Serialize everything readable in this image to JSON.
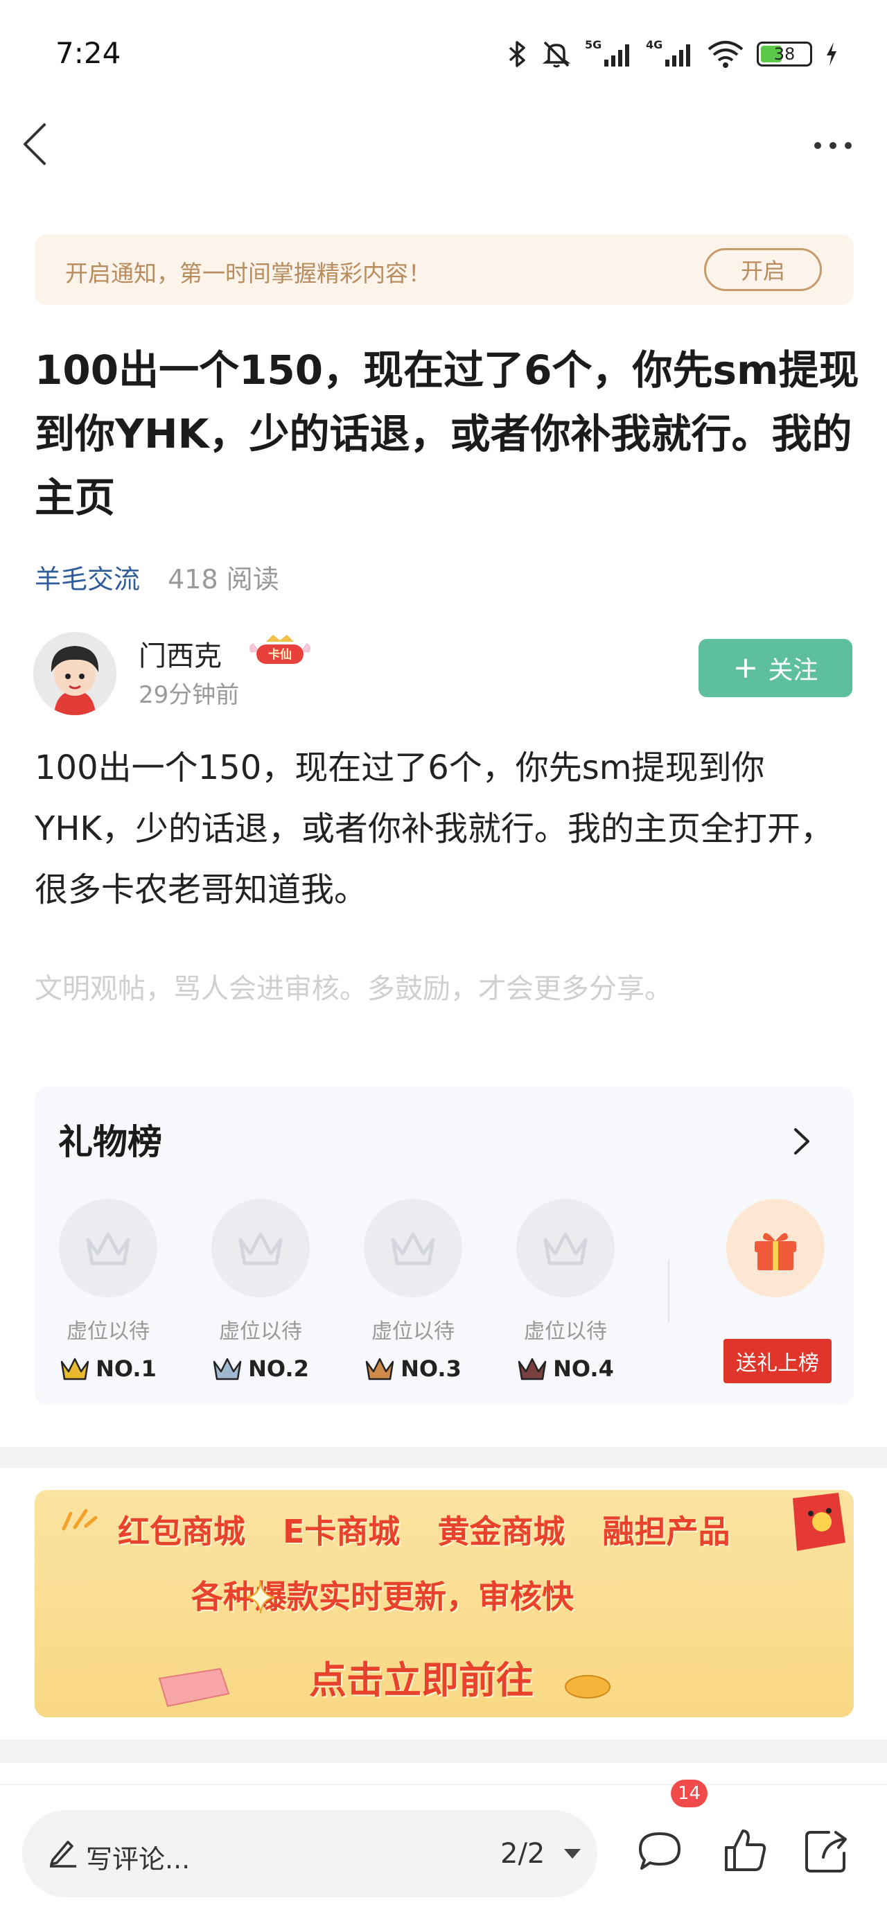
{
  "status_bar": {
    "time": "7:24",
    "network_1": "5G",
    "network_2": "4G",
    "battery": "38"
  },
  "notice": {
    "text": "开启通知，第一时间掌握精彩内容！",
    "button": "开启"
  },
  "post": {
    "title": "100出一个150，现在过了6个，你先sm提现到你YHK，少的话退，或者你补我就行。我的主页",
    "topic": "羊毛交流",
    "reads": "418 阅读",
    "author": {
      "name": "门西克",
      "badge": "卡仙",
      "time": "29分钟前",
      "follow_label": "关注"
    },
    "body": "100出一个150，现在过了6个，你先sm提现到你YHK，少的话退，或者你补我就行。我的主页全打开，很多卡农老哥知道我。",
    "hint": "文明观帖，骂人会进审核。多鼓励，才会更多分享。"
  },
  "gift_board": {
    "title": "礼物榜",
    "slots": [
      {
        "label": "虚位以待",
        "rank": "NO.1",
        "crown_color": "#e8b92c"
      },
      {
        "label": "虚位以待",
        "rank": "NO.2",
        "crown_color": "#7f9bb8"
      },
      {
        "label": "虚位以待",
        "rank": "NO.3",
        "crown_color": "#d08a4a"
      },
      {
        "label": "虚位以待",
        "rank": "NO.4",
        "crown_color": "#6a3a3a"
      }
    ],
    "send_button": "送礼上榜"
  },
  "ad": {
    "row1": [
      "红包商城",
      "E卡商城",
      "黄金商城",
      "融担产品"
    ],
    "row2": "各种爆款实时更新，审核快",
    "row3": "点击立即前往"
  },
  "bottom_bar": {
    "comment_placeholder": "写评论...",
    "page_indicator": "2/2",
    "comment_count": "14"
  },
  "colors": {
    "accent_green": "#5dbf9e",
    "topic_blue": "#2f5d9a",
    "notice_bg": "#fcf3ea",
    "send_red": "#e0352b"
  }
}
